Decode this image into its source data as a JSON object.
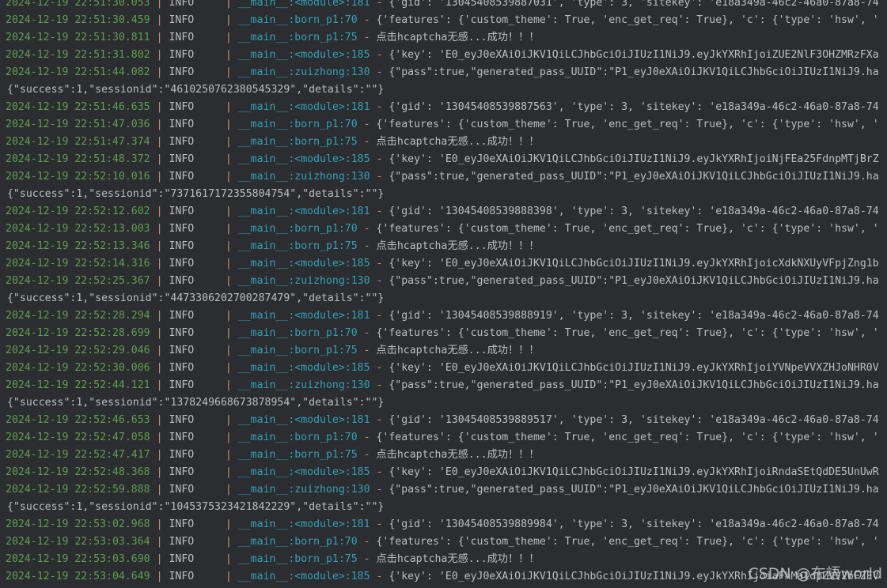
{
  "colors": {
    "background": "#2b2d30",
    "timestamp": "#5f9f4e",
    "separator": "#cf8e6d",
    "module": "#33a0b6",
    "text": "#bcbec4"
  },
  "watermark": "CSDN @布語world",
  "lines": [
    {
      "type": "log",
      "ts": "2024-12-19 22:51:30.053",
      "level": "INFO",
      "module": "__main__:<module>:181",
      "msg": "{'gid': '13045408539887031', 'type': 3, 'sitekey': 'e18a349a-46c2-46a0-87a8-74"
    },
    {
      "type": "log",
      "ts": "2024-12-19 22:51:30.459",
      "level": "INFO",
      "module": "__main__:born_p1:70",
      "msg": "{'features': {'custom_theme': True, 'enc_get_req': True}, 'c': {'type': 'hsw', '"
    },
    {
      "type": "log",
      "ts": "2024-12-19 22:51:30.811",
      "level": "INFO",
      "module": "__main__:born_p1:75",
      "msg": "点击hcaptcha无感...成功！！！"
    },
    {
      "type": "log",
      "ts": "2024-12-19 22:51:31.802",
      "level": "INFO",
      "module": "__main__:<module>:185",
      "msg": "{'key': 'E0_eyJ0eXAiOiJKV1QiLCJhbGciOiJIUzI1NiJ9.eyJkYXRhIjoiZUE2NlF3OHZMRzFXa"
    },
    {
      "type": "log",
      "ts": "2024-12-19 22:51:44.082",
      "level": "INFO",
      "module": "__main__:zuizhong:130",
      "msg": "{\"pass\":true,\"generated_pass_UUID\":\"P1_eyJ0eXAiOiJKV1QiLCJhbGciOiJIUzI1NiJ9.ha"
    },
    {
      "type": "raw",
      "text": "{\"success\":1,\"sessionid\":\"4610250762380545329\",\"details\":\"\"}"
    },
    {
      "type": "log",
      "ts": "2024-12-19 22:51:46.635",
      "level": "INFO",
      "module": "__main__:<module>:181",
      "msg": "{'gid': '13045408539887563', 'type': 3, 'sitekey': 'e18a349a-46c2-46a0-87a8-74"
    },
    {
      "type": "log",
      "ts": "2024-12-19 22:51:47.036",
      "level": "INFO",
      "module": "__main__:born_p1:70",
      "msg": "{'features': {'custom_theme': True, 'enc_get_req': True}, 'c': {'type': 'hsw', '"
    },
    {
      "type": "log",
      "ts": "2024-12-19 22:51:47.374",
      "level": "INFO",
      "module": "__main__:born_p1:75",
      "msg": "点击hcaptcha无感...成功！！！"
    },
    {
      "type": "log",
      "ts": "2024-12-19 22:51:48.372",
      "level": "INFO",
      "module": "__main__:<module>:185",
      "msg": "{'key': 'E0_eyJ0eXAiOiJKV1QiLCJhbGciOiJIUzI1NiJ9.eyJkYXRhIjoiNjFEa25FdnpMTjBrZ"
    },
    {
      "type": "log",
      "ts": "2024-12-19 22:52:10.016",
      "level": "INFO",
      "module": "__main__:zuizhong:130",
      "msg": "{\"pass\":true,\"generated_pass_UUID\":\"P1_eyJ0eXAiOiJKV1QiLCJhbGciOiJIUzI1NiJ9.ha"
    },
    {
      "type": "raw",
      "text": "{\"success\":1,\"sessionid\":\"7371617172355804754\",\"details\":\"\"}"
    },
    {
      "type": "log",
      "ts": "2024-12-19 22:52:12.602",
      "level": "INFO",
      "module": "__main__:<module>:181",
      "msg": "{'gid': '13045408539888398', 'type': 3, 'sitekey': 'e18a349a-46c2-46a0-87a8-74"
    },
    {
      "type": "log",
      "ts": "2024-12-19 22:52:13.003",
      "level": "INFO",
      "module": "__main__:born_p1:70",
      "msg": "{'features': {'custom_theme': True, 'enc_get_req': True}, 'c': {'type': 'hsw', '"
    },
    {
      "type": "log",
      "ts": "2024-12-19 22:52:13.346",
      "level": "INFO",
      "module": "__main__:born_p1:75",
      "msg": "点击hcaptcha无感...成功！！！"
    },
    {
      "type": "log",
      "ts": "2024-12-19 22:52:14.316",
      "level": "INFO",
      "module": "__main__:<module>:185",
      "msg": "{'key': 'E0_eyJ0eXAiOiJKV1QiLCJhbGciOiJIUzI1NiJ9.eyJkYXRhIjoicXdkNXUyVFpjZng1b"
    },
    {
      "type": "log",
      "ts": "2024-12-19 22:52:25.367",
      "level": "INFO",
      "module": "__main__:zuizhong:130",
      "msg": "{\"pass\":true,\"generated_pass_UUID\":\"P1_eyJ0eXAiOiJKV1QiLCJhbGciOiJIUzI1NiJ9.ha"
    },
    {
      "type": "raw",
      "text": "{\"success\":1,\"sessionid\":\"4473306202700287479\",\"details\":\"\"}"
    },
    {
      "type": "log",
      "ts": "2024-12-19 22:52:28.294",
      "level": "INFO",
      "module": "__main__:<module>:181",
      "msg": "{'gid': '13045408539888919', 'type': 3, 'sitekey': 'e18a349a-46c2-46a0-87a8-74"
    },
    {
      "type": "log",
      "ts": "2024-12-19 22:52:28.699",
      "level": "INFO",
      "module": "__main__:born_p1:70",
      "msg": "{'features': {'custom_theme': True, 'enc_get_req': True}, 'c': {'type': 'hsw', '"
    },
    {
      "type": "log",
      "ts": "2024-12-19 22:52:29.046",
      "level": "INFO",
      "module": "__main__:born_p1:75",
      "msg": "点击hcaptcha无感...成功！！！"
    },
    {
      "type": "log",
      "ts": "2024-12-19 22:52:30.006",
      "level": "INFO",
      "module": "__main__:<module>:185",
      "msg": "{'key': 'E0_eyJ0eXAiOiJKV1QiLCJhbGciOiJIUzI1NiJ9.eyJkYXRhIjoiYVNpeVVXZHJoNHR0V"
    },
    {
      "type": "log",
      "ts": "2024-12-19 22:52:44.121",
      "level": "INFO",
      "module": "__main__:zuizhong:130",
      "msg": "{\"pass\":true,\"generated_pass_UUID\":\"P1_eyJ0eXAiOiJKV1QiLCJhbGciOiJIUzI1NiJ9.ha"
    },
    {
      "type": "raw",
      "text": "{\"success\":1,\"sessionid\":\"1378249668673878954\",\"details\":\"\"}"
    },
    {
      "type": "log",
      "ts": "2024-12-19 22:52:46.653",
      "level": "INFO",
      "module": "__main__:<module>:181",
      "msg": "{'gid': '13045408539889517', 'type': 3, 'sitekey': 'e18a349a-46c2-46a0-87a8-74"
    },
    {
      "type": "log",
      "ts": "2024-12-19 22:52:47.058",
      "level": "INFO",
      "module": "__main__:born_p1:70",
      "msg": "{'features': {'custom_theme': True, 'enc_get_req': True}, 'c': {'type': 'hsw', '"
    },
    {
      "type": "log",
      "ts": "2024-12-19 22:52:47.417",
      "level": "INFO",
      "module": "__main__:born_p1:75",
      "msg": "点击hcaptcha无感...成功！！！"
    },
    {
      "type": "log",
      "ts": "2024-12-19 22:52:48.368",
      "level": "INFO",
      "module": "__main__:<module>:185",
      "msg": "{'key': 'E0_eyJ0eXAiOiJKV1QiLCJhbGciOiJIUzI1NiJ9.eyJkYXRhIjoiRndaSEtQdDE5UnUwR"
    },
    {
      "type": "log",
      "ts": "2024-12-19 22:52:59.888",
      "level": "INFO",
      "module": "__main__:zuizhong:130",
      "msg": "{\"pass\":true,\"generated_pass_UUID\":\"P1_eyJ0eXAiOiJKV1QiLCJhbGciOiJIUzI1NiJ9.ha"
    },
    {
      "type": "raw",
      "text": "{\"success\":1,\"sessionid\":\"1045375323421842229\",\"details\":\"\"}"
    },
    {
      "type": "log",
      "ts": "2024-12-19 22:53:02.968",
      "level": "INFO",
      "module": "__main__:<module>:181",
      "msg": "{'gid': '13045408539889984', 'type': 3, 'sitekey': 'e18a349a-46c2-46a0-87a8-74"
    },
    {
      "type": "log",
      "ts": "2024-12-19 22:53:03.364",
      "level": "INFO",
      "module": "__main__:born_p1:70",
      "msg": "{'features': {'custom_theme': True, 'enc_get_req': True}, 'c': {'type': 'hsw', '"
    },
    {
      "type": "log",
      "ts": "2024-12-19 22:53:03.690",
      "level": "INFO",
      "module": "__main__:born_p1:75",
      "msg": "点击hcaptcha无感...成功！！！"
    },
    {
      "type": "log",
      "ts": "2024-12-19 22:53:04.649",
      "level": "INFO",
      "module": "__main__:<module>:185",
      "msg": "{'key': 'E0_eyJ0eXAiOiJKV1QiLCJhbGciOiJIUzI1NiJ9.eyJkYXRhIjoiaFhMa1dpZVV2bFZEV"
    }
  ]
}
